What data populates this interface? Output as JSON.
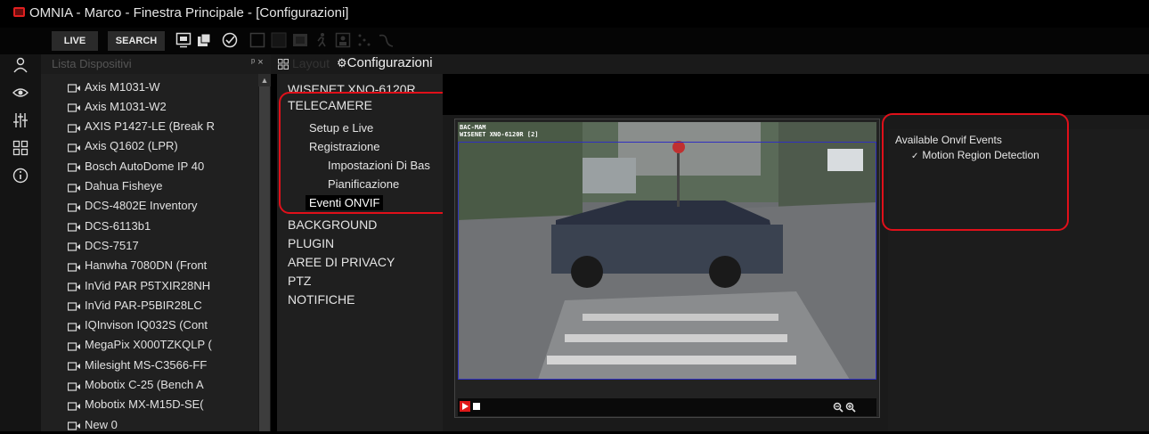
{
  "window": {
    "title": "OMNIA - Marco - Finestra Principale - [Configurazioni]"
  },
  "toolbar": {
    "live_label": "LIVE",
    "search_label": "SEARCH",
    "icons": [
      "monitor-icon",
      "windows-icon",
      "check-circle-icon",
      "square-icon",
      "black-square-icon",
      "filmstrip-icon",
      "user-walk-icon",
      "person-frame-icon",
      "dots-icon",
      "curve-icon"
    ]
  },
  "rail": {
    "icons": [
      "user-icon",
      "eye-icon",
      "sliders-icon",
      "grid-icon",
      "info-icon"
    ]
  },
  "device_panel": {
    "title": "Lista Dispositivi",
    "pin_close": "ᵖ ×",
    "devices": [
      "Axis M1031-W",
      "Axis M1031-W2",
      "AXIS P1427-LE (Break R",
      "Axis Q1602 (LPR)",
      "Bosch AutoDome IP 40",
      "Dahua Fisheye",
      "DCS-4802E Inventory",
      "DCS-6113b1",
      "DCS-7517",
      "Hanwha 7080DN (Front",
      "InVid PAR P5TXIR28NH",
      "InVid PAR-P5BIR28LC",
      "IQInvison IQ032S (Cont",
      "MegaPix X000TZKQLP (",
      "Milesight MS-C3566-FF",
      "Mobotix C-25 (Bench A",
      "Mobotix MX-M15D-SE(",
      "New 0"
    ]
  },
  "tabs": {
    "layout": "Layout",
    "config": "Configurazioni"
  },
  "tree": {
    "device": "WISENET XNO-6120R ...",
    "telecamere": "TELECAMERE",
    "setup_live": "Setup e Live",
    "registrazione": "Registrazione",
    "impostazioni": "Impostazioni Di Bas",
    "pianificazione": "Pianificazione",
    "eventi_onvif": "Eventi ONVIF",
    "background": "BACKGROUND",
    "plugin": "PLUGIN",
    "privacy": "AREE DI PRIVACY",
    "ptz": "PTZ",
    "notifiche": "NOTIFICHE"
  },
  "video": {
    "label_line1": "BAC-MAM",
    "label_line2": "WISENET XNO-6120R [2]"
  },
  "events": {
    "title": "Available Onvif Events",
    "items": [
      "Motion Region Detection"
    ]
  },
  "colors": {
    "highlight": "#e0101a",
    "accent_red": "#e02020"
  }
}
